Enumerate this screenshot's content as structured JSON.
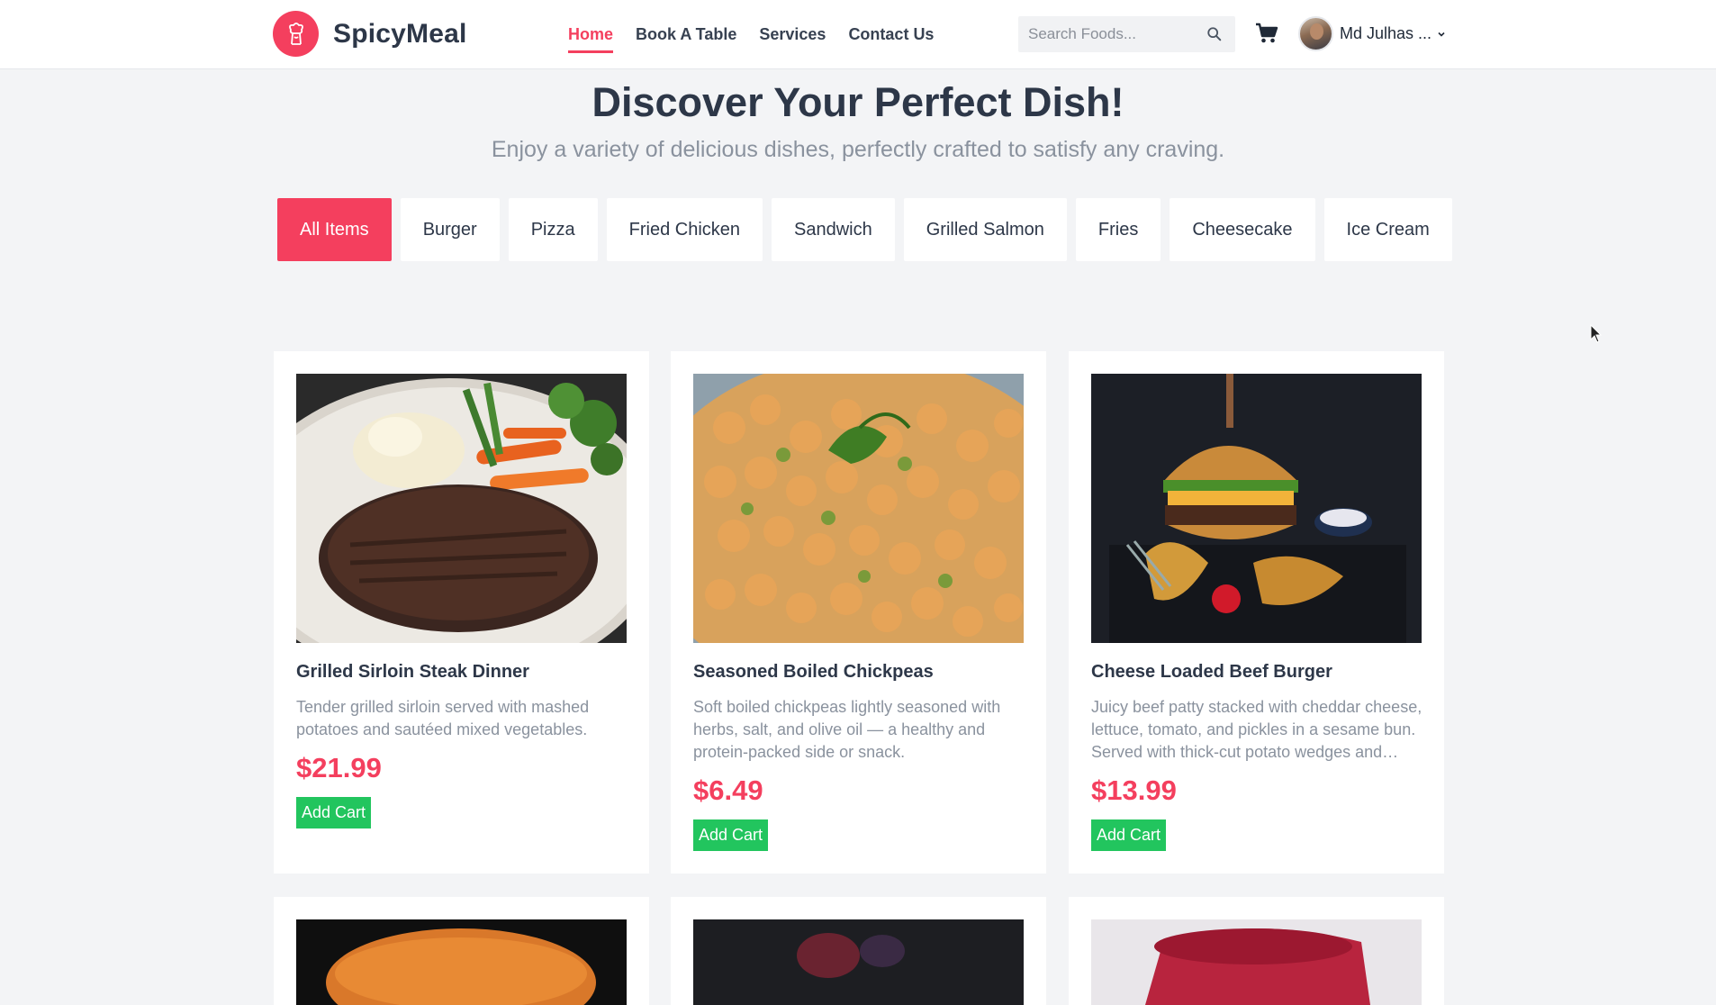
{
  "brand": {
    "name": "SpicyMeal",
    "accent": "#f43f5e"
  },
  "nav": {
    "links": [
      {
        "label": "Home",
        "active": true
      },
      {
        "label": "Book A Table",
        "active": false
      },
      {
        "label": "Services",
        "active": false
      },
      {
        "label": "Contact Us",
        "active": false
      }
    ]
  },
  "search": {
    "placeholder": "Search Foods..."
  },
  "user": {
    "name": "Md Julhas ..."
  },
  "hero": {
    "title": "Discover Your Perfect Dish!",
    "subtitle": "Enjoy a variety of delicious dishes, perfectly crafted to satisfy any craving."
  },
  "filters": [
    {
      "label": "All Items",
      "active": true
    },
    {
      "label": "Burger",
      "active": false
    },
    {
      "label": "Pizza",
      "active": false
    },
    {
      "label": "Fried Chicken",
      "active": false
    },
    {
      "label": "Sandwich",
      "active": false
    },
    {
      "label": "Grilled Salmon",
      "active": false
    },
    {
      "label": "Fries",
      "active": false
    },
    {
      "label": "Cheesecake",
      "active": false
    },
    {
      "label": "Ice Cream",
      "active": false
    }
  ],
  "products": [
    {
      "name": "Grilled Sirloin Steak Dinner",
      "description": "Tender grilled sirloin served with mashed potatoes and sautéed mixed vegetables.",
      "price": "$21.99",
      "button": "Add Cart"
    },
    {
      "name": "Seasoned Boiled Chickpeas",
      "description": "Soft boiled chickpeas lightly seasoned with herbs, salt, and olive oil — a healthy and protein-packed side or snack.",
      "price": "$6.49",
      "button": "Add Cart"
    },
    {
      "name": "Cheese Loaded Beef Burger",
      "description": "Juicy beef patty stacked with cheddar cheese, lettuce, tomato, and pickles in a sesame bun. Served with thick-cut potato wedges and…",
      "price": "$13.99",
      "button": "Add Cart"
    }
  ],
  "colors": {
    "add_button": "#22c55e",
    "price": "#f43f5e",
    "background": "#f3f4f6"
  }
}
